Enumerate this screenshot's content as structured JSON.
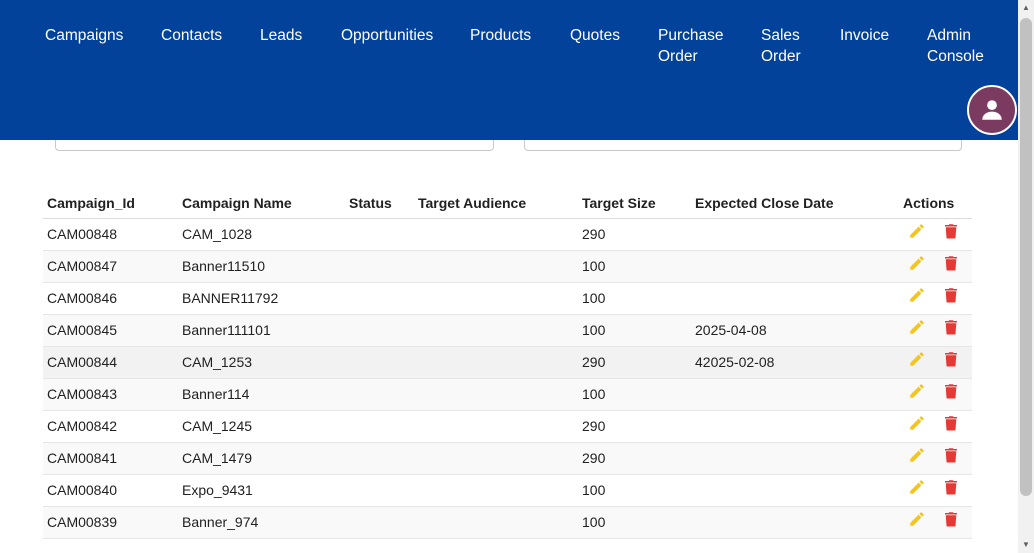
{
  "nav": {
    "campaigns": "Campaigns",
    "contacts": "Contacts",
    "leads": "Leads",
    "opportunities": "Opportunities",
    "products": "Products",
    "quotes": "Quotes",
    "purchase_order_1": "Purchase",
    "purchase_order_2": "Order",
    "sales_order_1": "Sales",
    "sales_order_2": "Order",
    "invoice": "Invoice",
    "admin_console_1": "Admin",
    "admin_console_2": "Console"
  },
  "avatar_icon": "user-icon",
  "table": {
    "headers": {
      "campaign_id": "Campaign_Id",
      "campaign_name": "Campaign Name",
      "status": "Status",
      "target_audience": "Target Audience",
      "target_size": "Target Size",
      "expected_close_date": "Expected Close Date",
      "actions": "Actions"
    },
    "rows": [
      {
        "id": "CAM00848",
        "name": "CAM_1028",
        "status": "",
        "audience": "",
        "size": "290",
        "close_date": ""
      },
      {
        "id": "CAM00847",
        "name": "Banner11510",
        "status": "",
        "audience": "",
        "size": "100",
        "close_date": ""
      },
      {
        "id": "CAM00846",
        "name": "BANNER11792",
        "status": "",
        "audience": "",
        "size": "100",
        "close_date": ""
      },
      {
        "id": "CAM00845",
        "name": "Banner111101",
        "status": "",
        "audience": "",
        "size": "100",
        "close_date": "2025-04-08"
      },
      {
        "id": "CAM00844",
        "name": "CAM_1253",
        "status": "",
        "audience": "",
        "size": "290",
        "close_date": "42025-02-08"
      },
      {
        "id": "CAM00843",
        "name": "Banner114",
        "status": "",
        "audience": "",
        "size": "100",
        "close_date": ""
      },
      {
        "id": "CAM00842",
        "name": "CAM_1245",
        "status": "",
        "audience": "",
        "size": "290",
        "close_date": ""
      },
      {
        "id": "CAM00841",
        "name": "CAM_1479",
        "status": "",
        "audience": "",
        "size": "290",
        "close_date": ""
      },
      {
        "id": "CAM00840",
        "name": "Expo_9431",
        "status": "",
        "audience": "",
        "size": "100",
        "close_date": ""
      },
      {
        "id": "CAM00839",
        "name": "Banner_974",
        "status": "",
        "audience": "",
        "size": "100",
        "close_date": ""
      }
    ]
  },
  "icons": {
    "edit": "pencil-icon",
    "delete": "trash-icon"
  },
  "colors": {
    "navbar": "#02429a",
    "avatar": "#7b3a5f",
    "edit_icon": "#f5c518",
    "delete_icon": "#e53935"
  }
}
